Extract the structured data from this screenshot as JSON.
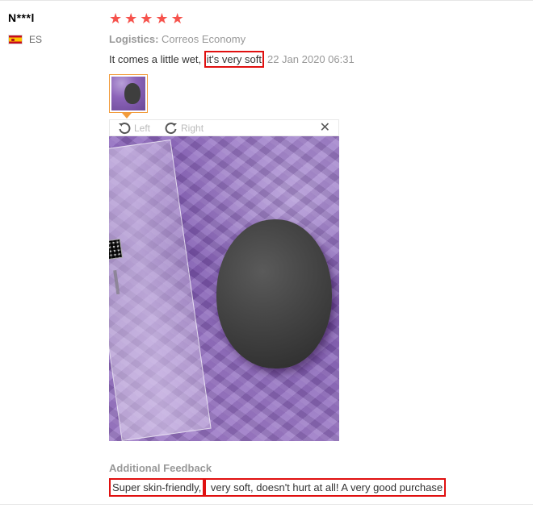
{
  "reviewer": {
    "name": "N***l",
    "country": "ES"
  },
  "rating": {
    "stars": 5,
    "max": 5
  },
  "logistics": {
    "label": "Logistics:",
    "value": "Correos Economy"
  },
  "feedback": {
    "text_plain": "It comes a little wet, ",
    "text_highlight": "it's very soft",
    "date": "22 Jan 2020 06:31"
  },
  "image_viewer": {
    "rotate_left_label": "Left",
    "rotate_right_label": "Right"
  },
  "additional_feedback": {
    "label": "Additional Feedback",
    "part1_highlight": "Super skin-friendly,",
    "part2_highlight": " very soft, doesn't hurt at all! A very good purchase"
  },
  "colors": {
    "star": "#f6524c",
    "highlight_border": "#e01010",
    "thumb_border": "#f29b3b"
  },
  "icons": [
    "spain-flag-icon",
    "star-icon",
    "rotate-left-icon",
    "rotate-right-icon",
    "close-icon"
  ]
}
